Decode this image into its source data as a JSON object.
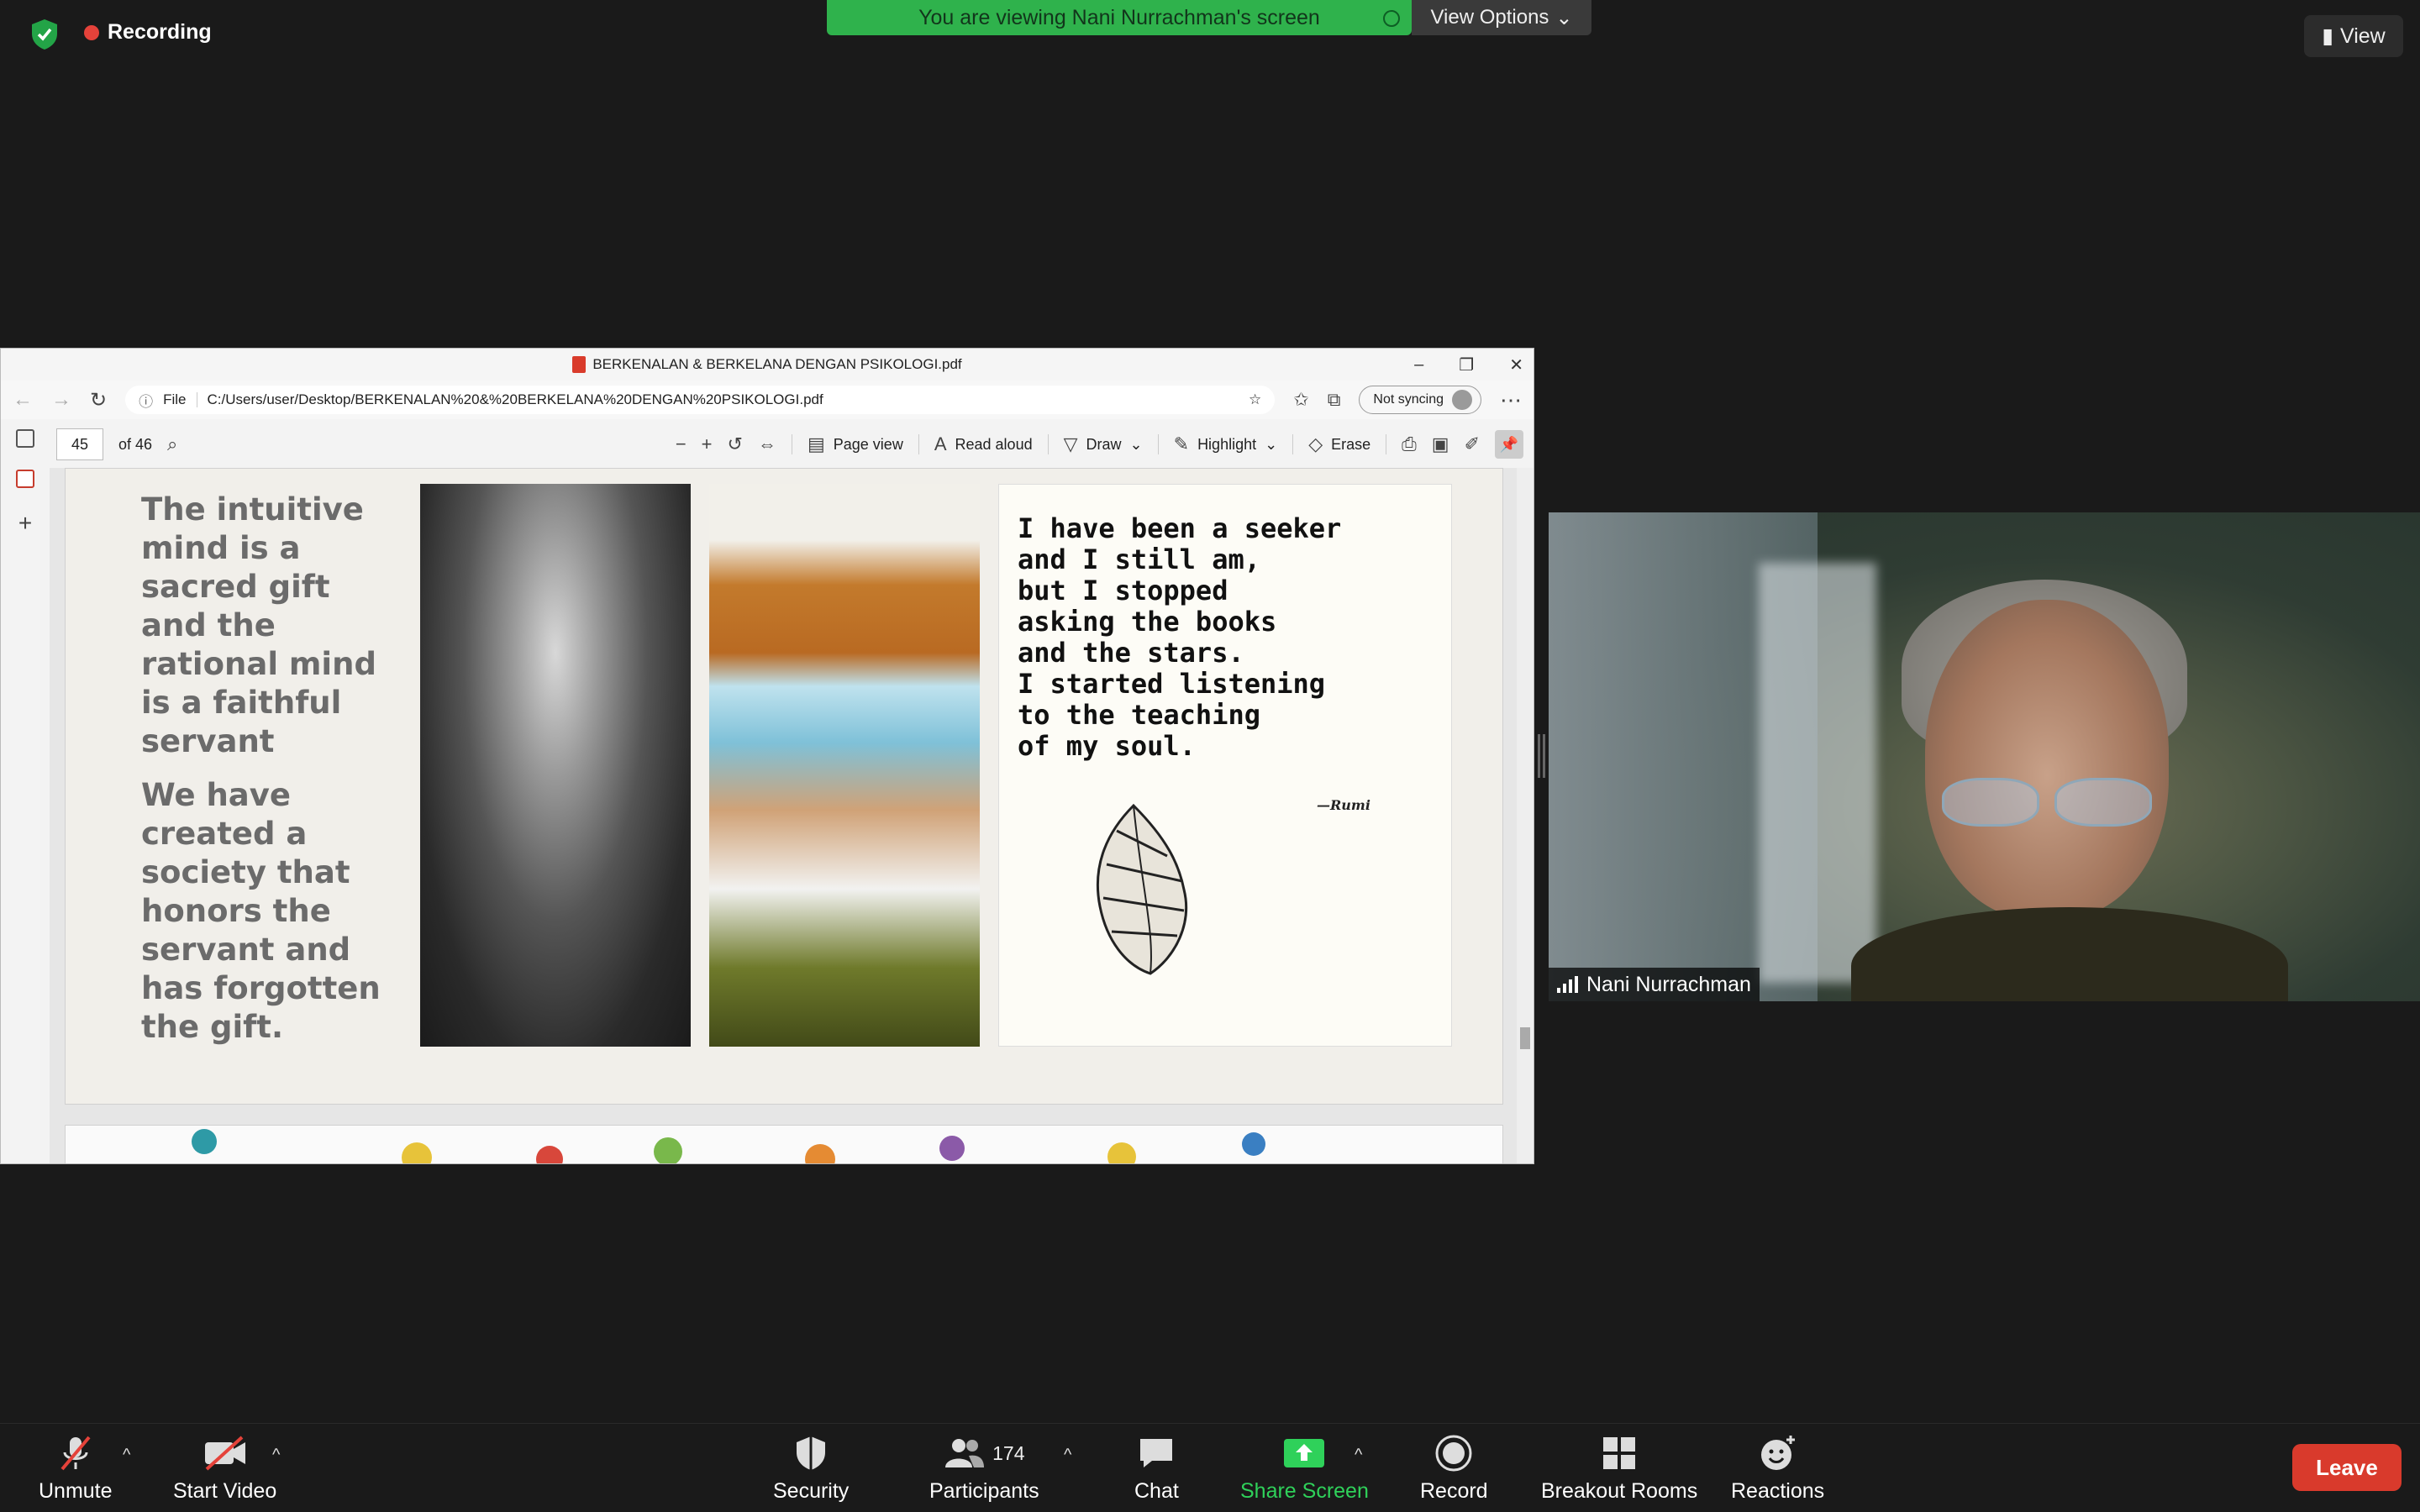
{
  "top": {
    "recording_label": "Recording",
    "viewing_banner": "You are viewing Nani Nurrachman's screen",
    "view_options_label": "View Options",
    "view_button_label": "View"
  },
  "window": {
    "title": "BERKENALAN & BERKELANA DENGAN PSIKOLOGI.pdf",
    "address_scheme": "File",
    "address_url": "C:/Users/user/Desktop/BERKENALAN%20&%20BERKELANA%20DENGAN%20PSIKOLOGI.pdf",
    "sync_label": "Not syncing"
  },
  "pdf_toolbar": {
    "page_current": "45",
    "page_total": "of 46",
    "page_view": "Page view",
    "read_aloud": "Read aloud",
    "draw": "Draw",
    "highlight": "Highlight",
    "erase": "Erase"
  },
  "slide": {
    "quote_part1": "The intuitive mind is a sacred gift and the rational mind is a faithful servant",
    "quote_part2": "We have created a society that honors the servant and has forgotten the gift.",
    "poem": "I have been a seeker\nand I still am,\nbut I stopped\nasking the books\nand the stars.\nI started listening\nto the teaching\nof my soul.",
    "poem_attribution": "—Rumi"
  },
  "participant_video": {
    "name": "Nani Nurrachman"
  },
  "bottom_toolbar": {
    "unmute": "Unmute",
    "start_video": "Start Video",
    "security": "Security",
    "participants": "Participants",
    "participants_count": "174",
    "chat": "Chat",
    "share_screen": "Share Screen",
    "record": "Record",
    "breakout_rooms": "Breakout Rooms",
    "reactions": "Reactions",
    "leave": "Leave"
  },
  "colors": {
    "banner_green": "#2fb24c",
    "share_green": "#2fd15a",
    "leave_red": "#d93a2c",
    "recording_red": "#e5423a"
  }
}
